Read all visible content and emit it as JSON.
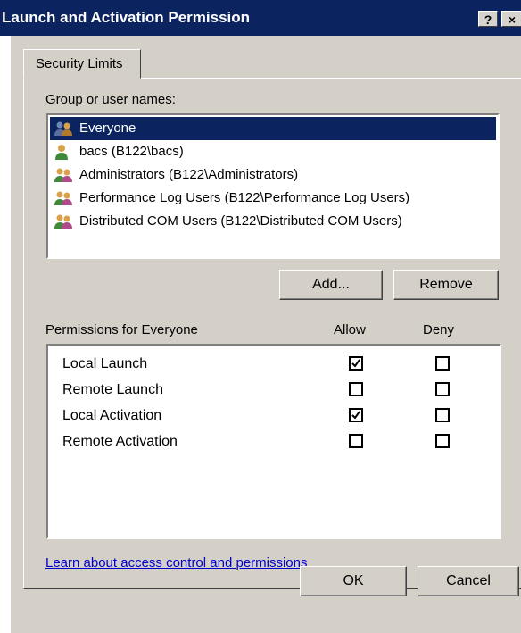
{
  "window": {
    "title": "Launch and Activation Permission",
    "help_button": "?",
    "close_button": "×"
  },
  "tabs": [
    {
      "label": "Security Limits"
    }
  ],
  "group_section": {
    "label": "Group or user names:",
    "users": [
      {
        "name": "Everyone",
        "icon": "group-icon",
        "selected": true
      },
      {
        "name": "bacs (B122\\bacs)",
        "icon": "user-icon",
        "selected": false
      },
      {
        "name": "Administrators (B122\\Administrators)",
        "icon": "group-icon",
        "selected": false
      },
      {
        "name": "Performance Log Users (B122\\Performance Log Users)",
        "icon": "group-icon",
        "selected": false
      },
      {
        "name": "Distributed COM Users (B122\\Distributed COM Users)",
        "icon": "group-icon",
        "selected": false
      }
    ],
    "add_button": "Add...",
    "remove_button": "Remove"
  },
  "permissions": {
    "header": "Permissions for Everyone",
    "allow_header": "Allow",
    "deny_header": "Deny",
    "rows": [
      {
        "name": "Local Launch",
        "allow": true,
        "deny": false
      },
      {
        "name": "Remote Launch",
        "allow": false,
        "deny": false
      },
      {
        "name": "Local Activation",
        "allow": true,
        "deny": false
      },
      {
        "name": "Remote Activation",
        "allow": false,
        "deny": false
      }
    ]
  },
  "link": "Learn about access control and permissions",
  "footer": {
    "ok_button": "OK",
    "cancel_button": "Cancel"
  },
  "colors": {
    "titlebar": "#0b2460",
    "dialog_face": "#d4d0c8",
    "selection": "#0b2460",
    "link": "#0000cc"
  }
}
